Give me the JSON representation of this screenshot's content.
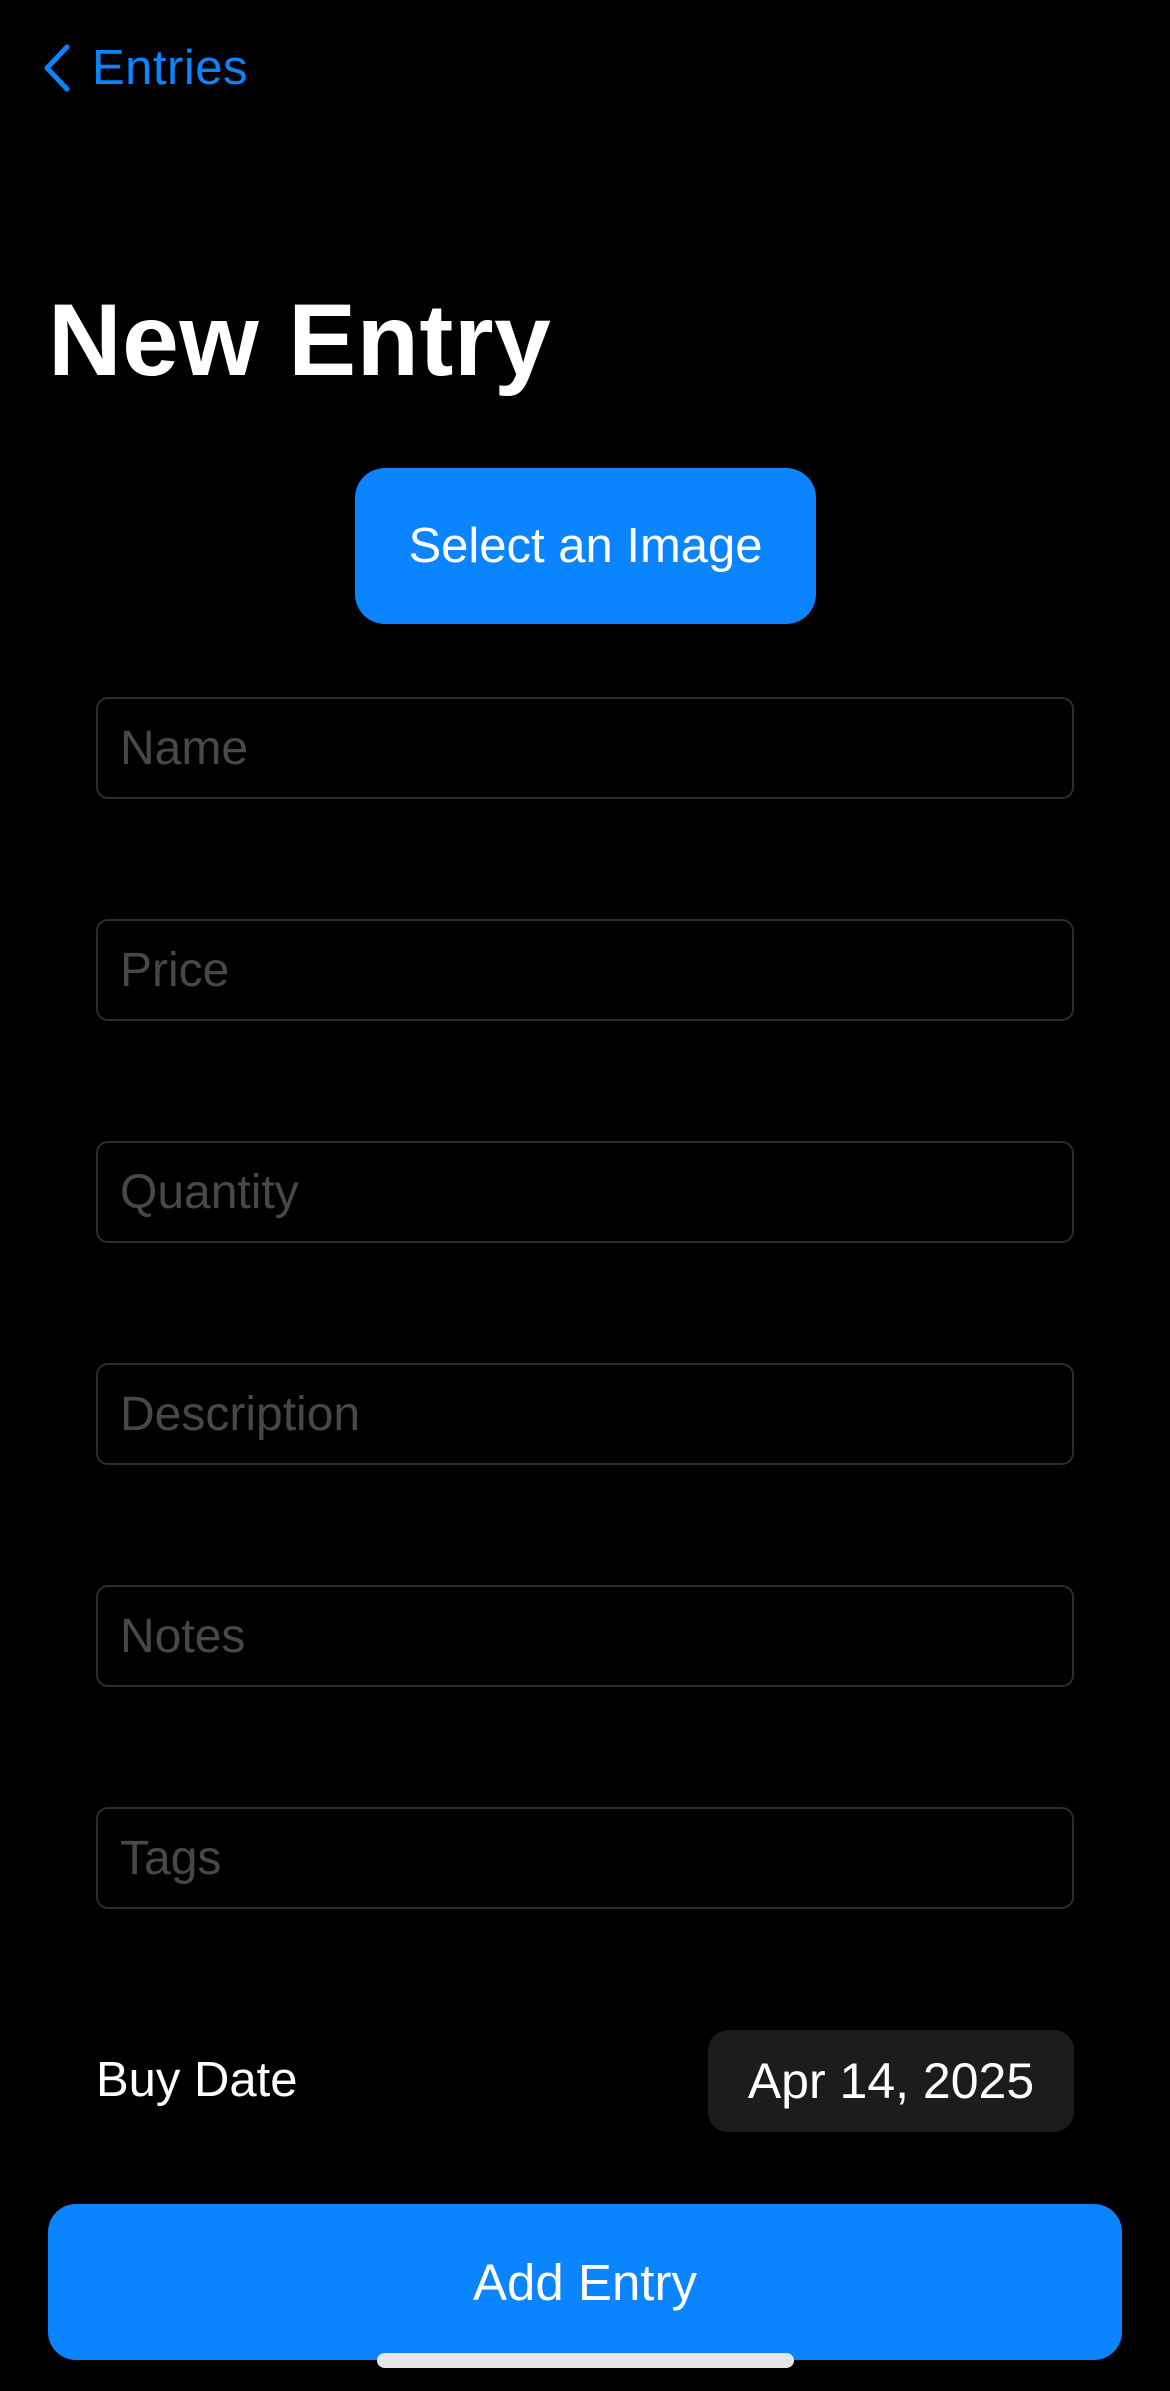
{
  "nav": {
    "back_label": "Entries",
    "back_icon": "chevron-left-icon"
  },
  "header": {
    "title": "New Entry"
  },
  "image_picker": {
    "label": "Select an Image"
  },
  "form": {
    "fields": [
      {
        "id": "name",
        "placeholder": "Name",
        "value": ""
      },
      {
        "id": "price",
        "placeholder": "Price",
        "value": ""
      },
      {
        "id": "quantity",
        "placeholder": "Quantity",
        "value": ""
      },
      {
        "id": "description",
        "placeholder": "Description",
        "value": ""
      },
      {
        "id": "notes",
        "placeholder": "Notes",
        "value": ""
      },
      {
        "id": "tags",
        "placeholder": "Tags",
        "value": ""
      }
    ],
    "buy_date": {
      "label": "Buy Date",
      "value": "Apr 14, 2025"
    }
  },
  "actions": {
    "add_label": "Add Entry"
  },
  "colors": {
    "accent": "#0a84ff",
    "background": "#000000",
    "field_border": "#2c2c2e",
    "placeholder": "#48484a",
    "date_pill": "#1c1c1e"
  }
}
